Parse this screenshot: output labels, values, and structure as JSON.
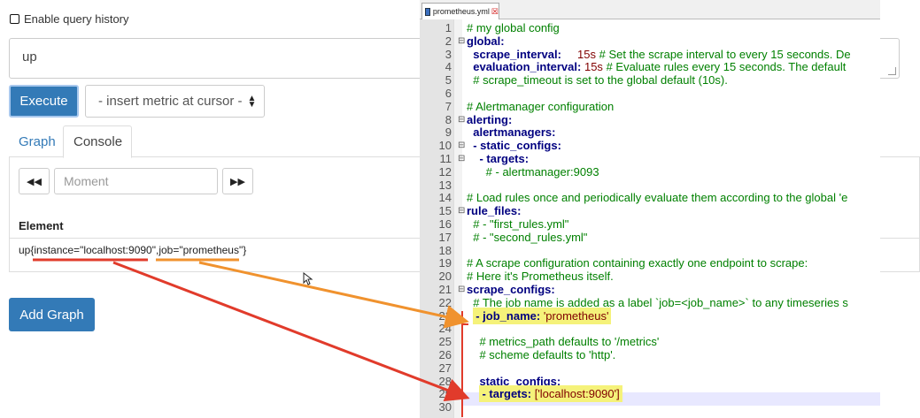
{
  "left": {
    "history_label": "Enable query history",
    "query_value": "up",
    "execute_label": "Execute",
    "metric_select": "- insert metric at cursor -",
    "tabs": [
      "Graph",
      "Console"
    ],
    "nav_prev": "◀◀",
    "nav_next": "▶▶",
    "moment_placeholder": "Moment",
    "element_header": "Element",
    "element_row": {
      "prefix": "up{",
      "instance": "instance=\"localhost:9090\"",
      "sep": ",",
      "job": "job=\"prometheus\"",
      "suffix": "}"
    },
    "add_graph_label": "Add Graph"
  },
  "editor": {
    "file_tab": "prometheus.yml",
    "lines": [
      {
        "n": "1",
        "t": "# my global config",
        "type": "comment"
      },
      {
        "n": "2",
        "t": "global:",
        "type": "kw",
        "fold": "⊟"
      },
      {
        "n": "3",
        "t": "  scrape_interval:     15s # Set the scrape interval to every 15 seconds. De",
        "type": "kv"
      },
      {
        "n": "4",
        "t": "  evaluation_interval: 15s # Evaluate rules every 15 seconds. The default",
        "type": "kv"
      },
      {
        "n": "5",
        "t": "  # scrape_timeout is set to the global default (10s).",
        "type": "comment"
      },
      {
        "n": "6",
        "t": "",
        "type": "plain"
      },
      {
        "n": "7",
        "t": "# Alertmanager configuration",
        "type": "comment"
      },
      {
        "n": "8",
        "t": "alerting:",
        "type": "kw",
        "fold": "⊟"
      },
      {
        "n": "9",
        "t": "  alertmanagers:",
        "type": "kw"
      },
      {
        "n": "10",
        "t": "  - static_configs:",
        "type": "kw",
        "fold": "⊟"
      },
      {
        "n": "11",
        "t": "    - targets:",
        "type": "kw",
        "fold": "⊟"
      },
      {
        "n": "12",
        "t": "      # - alertmanager:9093",
        "type": "comment"
      },
      {
        "n": "13",
        "t": "",
        "type": "plain"
      },
      {
        "n": "14",
        "t": "# Load rules once and periodically evaluate them according to the global 'e",
        "type": "comment"
      },
      {
        "n": "15",
        "t": "rule_files:",
        "type": "kw",
        "fold": "⊟"
      },
      {
        "n": "16",
        "t": "  # - \"first_rules.yml\"",
        "type": "comment"
      },
      {
        "n": "17",
        "t": "  # - \"second_rules.yml\"",
        "type": "comment"
      },
      {
        "n": "18",
        "t": "",
        "type": "plain"
      },
      {
        "n": "19",
        "t": "# A scrape configuration containing exactly one endpoint to scrape:",
        "type": "comment"
      },
      {
        "n": "20",
        "t": "# Here it's Prometheus itself.",
        "type": "comment"
      },
      {
        "n": "21",
        "t": "scrape_configs:",
        "type": "kw",
        "fold": "⊟"
      },
      {
        "n": "22",
        "t": "  # The job name is added as a label `job=<job_name>` to any timeseries s",
        "type": "comment"
      },
      {
        "n": "23",
        "t": "  - job_name: 'prometheus'",
        "type": "job"
      },
      {
        "n": "24",
        "t": "",
        "type": "plain"
      },
      {
        "n": "25",
        "t": "    # metrics_path defaults to '/metrics'",
        "type": "comment"
      },
      {
        "n": "26",
        "t": "    # scheme defaults to 'http'.",
        "type": "comment"
      },
      {
        "n": "27",
        "t": "",
        "type": "plain"
      },
      {
        "n": "28",
        "t": "    static_configs:",
        "type": "kw"
      },
      {
        "n": "29",
        "t": "    - targets: ['localhost:9090']",
        "type": "targets"
      },
      {
        "n": "30",
        "t": "",
        "type": "plain"
      }
    ]
  },
  "colors": {
    "primary": "#337ab7",
    "arrow_red": "#e13b2b",
    "arrow_orange": "#f0922e",
    "highlight": "#f5f27a"
  }
}
